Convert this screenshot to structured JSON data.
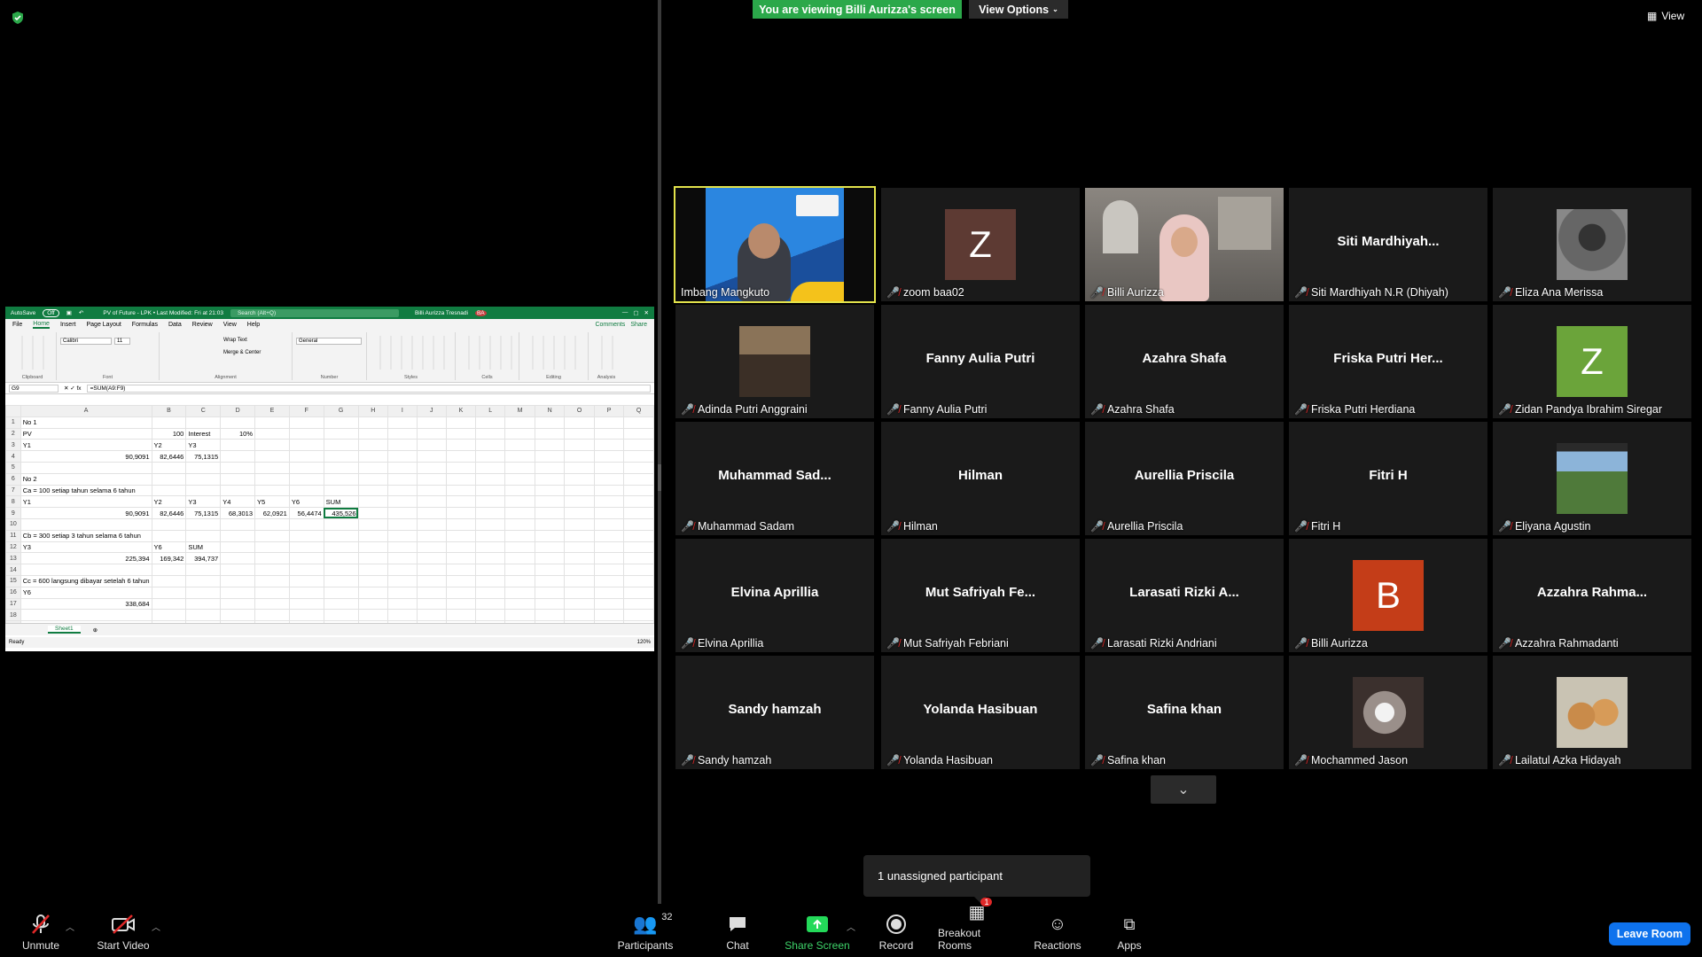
{
  "excel": {
    "autosave": "AutoSave",
    "autosave_state": "Off",
    "file_title": "PV of Future - LPK • Last Modified: Fri at 21:03",
    "search_placeholder": "Search (Alt+Q)",
    "user": "Billi Aurizza Tresnadi",
    "user_initials": "BA",
    "menu": [
      "File",
      "Home",
      "Insert",
      "Page Layout",
      "Formulas",
      "Data",
      "Review",
      "View",
      "Help"
    ],
    "comments": "Comments",
    "share": "Share",
    "ribbon_groups": [
      "Clipboard",
      "Font",
      "Alignment",
      "Number",
      "Styles",
      "Cells",
      "Editing",
      "Analysis"
    ],
    "font_name": "Calibri",
    "font_size": "11",
    "number_format": "General",
    "wrap_text": "Wrap Text",
    "merge_center": "Merge & Center",
    "name_box": "G9",
    "formula": "=SUM(A9:F9)",
    "columns": [
      "A",
      "B",
      "C",
      "D",
      "E",
      "F",
      "G",
      "H",
      "I",
      "J",
      "K",
      "L",
      "M",
      "N",
      "O",
      "P",
      "Q"
    ],
    "rows": [
      [
        "No 1",
        "",
        "",
        "",
        "",
        "",
        "",
        "",
        ""
      ],
      [
        "PV",
        "100",
        "Interest",
        "10%",
        "",
        "",
        "",
        "",
        ""
      ],
      [
        "Y1",
        "Y2",
        "Y3",
        "",
        "",
        "",
        "",
        "",
        ""
      ],
      [
        "90,9091",
        "82,6446",
        "75,1315",
        "",
        "",
        "",
        "",
        "",
        ""
      ],
      [
        "",
        "",
        "",
        "",
        "",
        "",
        "",
        "",
        ""
      ],
      [
        "No 2",
        "",
        "",
        "",
        "",
        "",
        "",
        "",
        ""
      ],
      [
        "Ca = 100 setiap tahun selama 6 tahun",
        "",
        "",
        "",
        "",
        "",
        "",
        "",
        ""
      ],
      [
        "Y1",
        "Y2",
        "Y3",
        "Y4",
        "Y5",
        "Y6",
        "SUM",
        "",
        ""
      ],
      [
        "90,9091",
        "82,6446",
        "75,1315",
        "68,3013",
        "62,0921",
        "56,4474",
        "435,526",
        "",
        ""
      ],
      [
        "",
        "",
        "",
        "",
        "",
        "",
        "",
        "",
        ""
      ],
      [
        "Cb = 300 setiap 3 tahun selama 6 tahun",
        "",
        "",
        "",
        "",
        "",
        "",
        "",
        ""
      ],
      [
        "Y3",
        "Y6",
        "SUM",
        "",
        "",
        "",
        "",
        "",
        ""
      ],
      [
        "225,394",
        "169,342",
        "394,737",
        "",
        "",
        "",
        "",
        "",
        ""
      ],
      [
        "",
        "",
        "",
        "",
        "",
        "",
        "",
        "",
        ""
      ],
      [
        "Cc = 600 langsung dibayar setelah 6 tahun",
        "",
        "",
        "",
        "",
        "",
        "",
        "",
        ""
      ],
      [
        "Y6",
        "",
        "",
        "",
        "",
        "",
        "",
        "",
        ""
      ],
      [
        "338,684",
        "",
        "",
        "",
        "",
        "",
        "",
        "",
        ""
      ],
      [
        "",
        "",
        "",
        "",
        "",
        "",
        "",
        "",
        ""
      ],
      [
        "",
        "",
        "",
        "",
        "",
        "",
        "",
        "",
        ""
      ]
    ],
    "sheet_tab": "Sheet1",
    "status": "Ready",
    "zoom": "120%"
  },
  "banner": {
    "text": "You are viewing Billi Aurizza's screen",
    "view_options": "View Options"
  },
  "view_button": "View",
  "participants": [
    {
      "label": "Imbang Mangkuto",
      "center": "",
      "muted": false,
      "kind": "video-blue"
    },
    {
      "label": "zoom baa02",
      "center": "",
      "muted": true,
      "kind": "avatar",
      "letter": "Z",
      "color": "#5d3a33"
    },
    {
      "label": "Billi Aurizza",
      "center": "",
      "muted": true,
      "kind": "video-room"
    },
    {
      "label": "Siti Mardhiyah N.R (Dhiyah)",
      "center": "Siti  Mardhiyah...",
      "muted": true,
      "kind": "name"
    },
    {
      "label": "Eliza Ana Merissa",
      "center": "",
      "muted": true,
      "kind": "photo-dark"
    },
    {
      "label": "Adinda Putri Anggraini",
      "center": "",
      "muted": true,
      "kind": "photo-room"
    },
    {
      "label": "Fanny Aulia Putri",
      "center": "Fanny Aulia Putri",
      "muted": true,
      "kind": "name"
    },
    {
      "label": "Azahra Shafa",
      "center": "Azahra Shafa",
      "muted": true,
      "kind": "name"
    },
    {
      "label": "Friska Putri Herdiana",
      "center": "Friska Putri Her...",
      "muted": true,
      "kind": "name"
    },
    {
      "label": "Zidan Pandya Ibrahim Siregar",
      "center": "",
      "muted": true,
      "kind": "avatar",
      "letter": "Z",
      "color": "#6ba43a"
    },
    {
      "label": "Muhammad Sadam",
      "center": "Muhammad  Sad...",
      "muted": true,
      "kind": "name"
    },
    {
      "label": "Hilman",
      "center": "Hilman",
      "muted": true,
      "kind": "name"
    },
    {
      "label": "Aurellia Priscila",
      "center": "Aurellia Priscila",
      "muted": true,
      "kind": "name"
    },
    {
      "label": "Fitri H",
      "center": "Fitri H",
      "muted": true,
      "kind": "name"
    },
    {
      "label": "Eliyana Agustin",
      "center": "",
      "muted": true,
      "kind": "photo-nature"
    },
    {
      "label": "Elvina Aprillia",
      "center": "Elvina Aprillia",
      "muted": true,
      "kind": "name"
    },
    {
      "label": "Mut Safriyah Febriani",
      "center": "Mut  Safriyah  Fe...",
      "muted": true,
      "kind": "name"
    },
    {
      "label": "Larasati Rizki Andriani",
      "center": "Larasati Rizki  A...",
      "muted": true,
      "kind": "name"
    },
    {
      "label": "Billi Aurizza",
      "center": "",
      "muted": true,
      "kind": "avatar",
      "letter": "B",
      "color": "#c43d18"
    },
    {
      "label": "Azzahra Rahmadanti",
      "center": "Azzahra  Rahma...",
      "muted": true,
      "kind": "name"
    },
    {
      "label": "Sandy hamzah",
      "center": "Sandy hamzah",
      "muted": true,
      "kind": "name"
    },
    {
      "label": "Yolanda Hasibuan",
      "center": "Yolanda Hasibuan",
      "muted": true,
      "kind": "name"
    },
    {
      "label": "Safina khan",
      "center": "Safina khan",
      "muted": true,
      "kind": "name"
    },
    {
      "label": "Mochammed Jason",
      "center": "",
      "muted": true,
      "kind": "photo-glass"
    },
    {
      "label": "Lailatul Azka Hidayah",
      "center": "",
      "muted": true,
      "kind": "photo-bears"
    }
  ],
  "tooltip": "1 unassigned participant",
  "toolbar": {
    "unmute": "Unmute",
    "start_video": "Start Video",
    "participants": "Participants",
    "participants_count": "32",
    "chat": "Chat",
    "share_screen": "Share Screen",
    "record": "Record",
    "breakout_rooms": "Breakout Rooms",
    "breakout_badge": "1",
    "reactions": "Reactions",
    "apps": "Apps",
    "leave": "Leave Room"
  },
  "colors": {
    "share_green": "#2ba84a",
    "leave_blue": "#0e72ed",
    "active_speaker": "#e3e34b",
    "excel_green": "#107c41"
  }
}
